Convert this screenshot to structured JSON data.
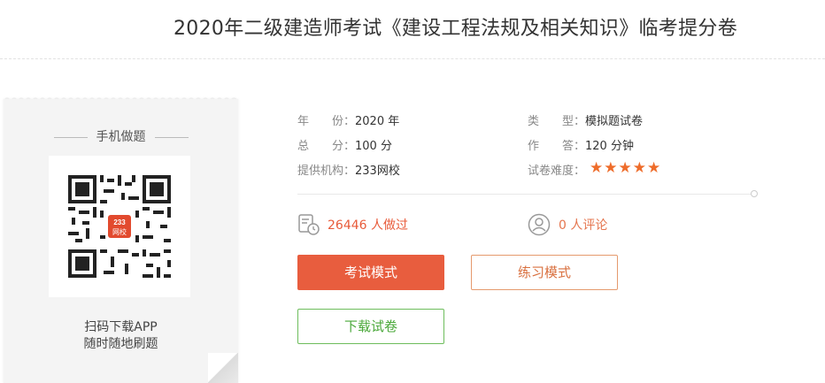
{
  "header": {
    "title": "2020年二级建造师考试《建设工程法规及相关知识》临考提分卷"
  },
  "card": {
    "title": "手机做题",
    "logo_line1": "233",
    "logo_line2": "网校",
    "line1": "扫码下载APP",
    "line2": "随时随地刷题"
  },
  "info": {
    "year_label": "年　　份：",
    "year_value": "2020 年",
    "type_label": "类　　型：",
    "type_value": "模拟题试卷",
    "score_label": "总　　分：",
    "score_value": "100 分",
    "time_label": "作　　答：",
    "time_value": "120 分钟",
    "org_label": "提供机构：",
    "org_value": "233网校",
    "difficulty_label": "试卷难度：",
    "difficulty_stars": 5
  },
  "stats": {
    "done_text": "26446 人做过",
    "comments_text": "0 人评论"
  },
  "buttons": {
    "exam": "考试模式",
    "practice": "练习模式",
    "download": "下载试卷"
  },
  "colors": {
    "accent": "#e85d3e",
    "green": "#4aa83a",
    "star": "#ee6c2a"
  }
}
